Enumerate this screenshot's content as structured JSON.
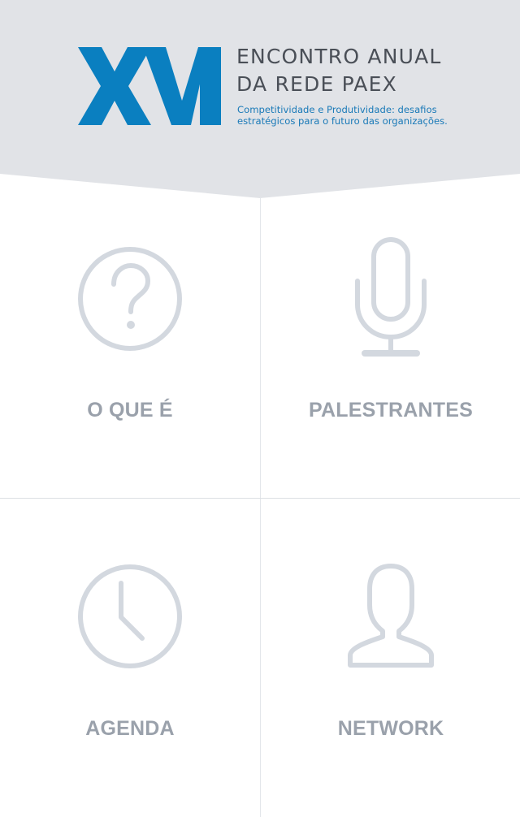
{
  "header": {
    "logo_text": "XVI",
    "title_line1": "ENCONTRO ANUAL",
    "title_line2": "DA REDE PAEX",
    "subtitle_line1": "Competitividade e Produtividade: desafios",
    "subtitle_line2": "estratégicos para o futuro das organizações."
  },
  "menu": [
    {
      "label": "O QUE É",
      "icon": "question-circle-icon"
    },
    {
      "label": "PALESTRANTES",
      "icon": "microphone-icon"
    },
    {
      "label": "AGENDA",
      "icon": "clock-icon"
    },
    {
      "label": "NETWORK",
      "icon": "user-icon"
    }
  ],
  "colors": {
    "header_bg": "#e1e3e7",
    "brand_blue": "#0a7fc0",
    "title_text": "#4a4f57",
    "subtitle_text": "#1a7ab8",
    "icon_gray": "#d3d8df",
    "label_gray": "#9aa1ab",
    "divider": "#e1e4e8"
  }
}
